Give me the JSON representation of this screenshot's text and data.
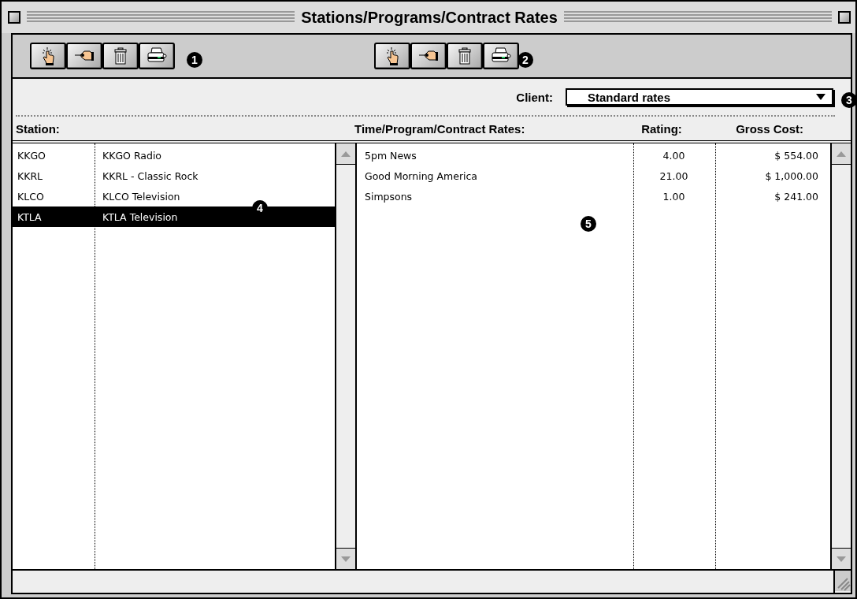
{
  "window": {
    "title": "Stations/Programs/Contract Rates"
  },
  "toolbars": [
    {
      "buttons": [
        {
          "kind": "point"
        },
        {
          "kind": "sign"
        },
        {
          "kind": "trash"
        },
        {
          "kind": "print"
        }
      ],
      "callout": "1"
    },
    {
      "buttons": [
        {
          "kind": "point"
        },
        {
          "kind": "sign"
        },
        {
          "kind": "trash"
        },
        {
          "kind": "print"
        }
      ],
      "callout": "2"
    }
  ],
  "client": {
    "label": "Client:",
    "value": "Standard rates",
    "callout": "3"
  },
  "stations": {
    "header": "Station:",
    "callout": "4",
    "rows": [
      {
        "code": "KKGO",
        "name": "KKGO Radio",
        "selected": false
      },
      {
        "code": "KKRL",
        "name": "KKRL - Classic Rock",
        "selected": false
      },
      {
        "code": "KLCO",
        "name": "KLCO Television",
        "selected": false
      },
      {
        "code": "KTLA",
        "name": "KTLA Television",
        "selected": true
      }
    ]
  },
  "rates": {
    "headers": [
      "Time/Program/Contract Rates:",
      "Rating:",
      "Gross Cost:"
    ],
    "callout": "5",
    "rows": [
      {
        "program": "5pm News",
        "rating": "4.00",
        "cost": "$ 554.00"
      },
      {
        "program": "Good Morning America",
        "rating": "21.00",
        "cost": "$ 1,000.00"
      },
      {
        "program": "Simpsons",
        "rating": "1.00",
        "cost": "$ 241.00"
      }
    ]
  }
}
